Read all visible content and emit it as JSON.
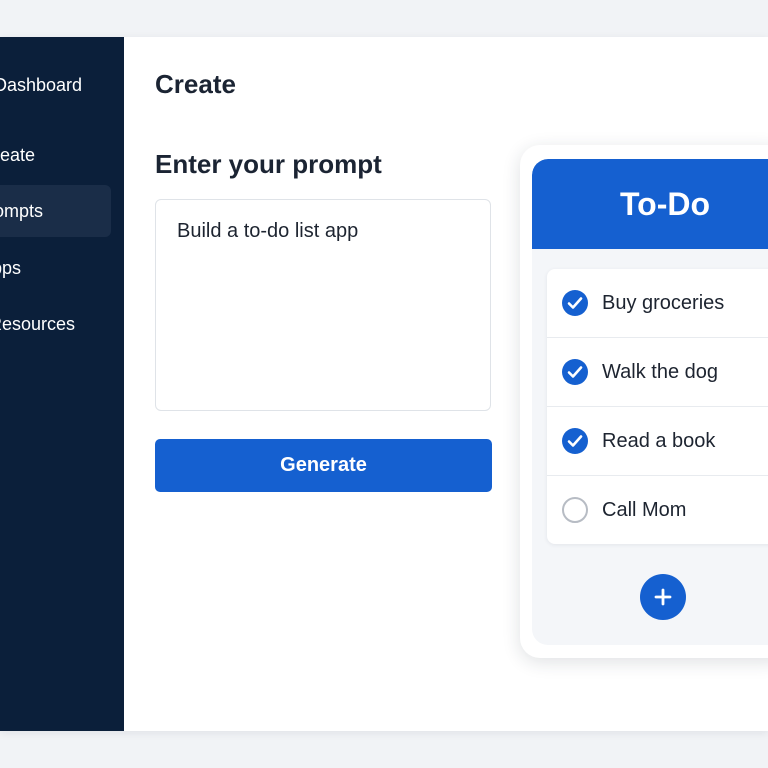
{
  "sidebar": {
    "items": [
      {
        "label": "Dashboard",
        "active": false
      },
      {
        "label": "Create",
        "active": false
      },
      {
        "label": "Prompts",
        "active": true
      },
      {
        "label": "Apps",
        "active": false
      },
      {
        "label": "Resources",
        "active": false
      }
    ]
  },
  "main": {
    "title": "Create",
    "prompt_heading": "Enter your prompt",
    "prompt_value": "Build a to-do list app",
    "generate_label": "Generate"
  },
  "preview": {
    "title": "To-Do",
    "items": [
      {
        "text": "Buy groceries",
        "done": true
      },
      {
        "text": "Walk the dog",
        "done": true
      },
      {
        "text": "Read a book",
        "done": true
      },
      {
        "text": "Call Mom",
        "done": false
      }
    ],
    "add_icon": "plus-icon"
  },
  "colors": {
    "sidebar_bg": "#0b1f3a",
    "sidebar_active": "#1a2d48",
    "accent": "#1560d0",
    "text_dark": "#1b2433"
  }
}
